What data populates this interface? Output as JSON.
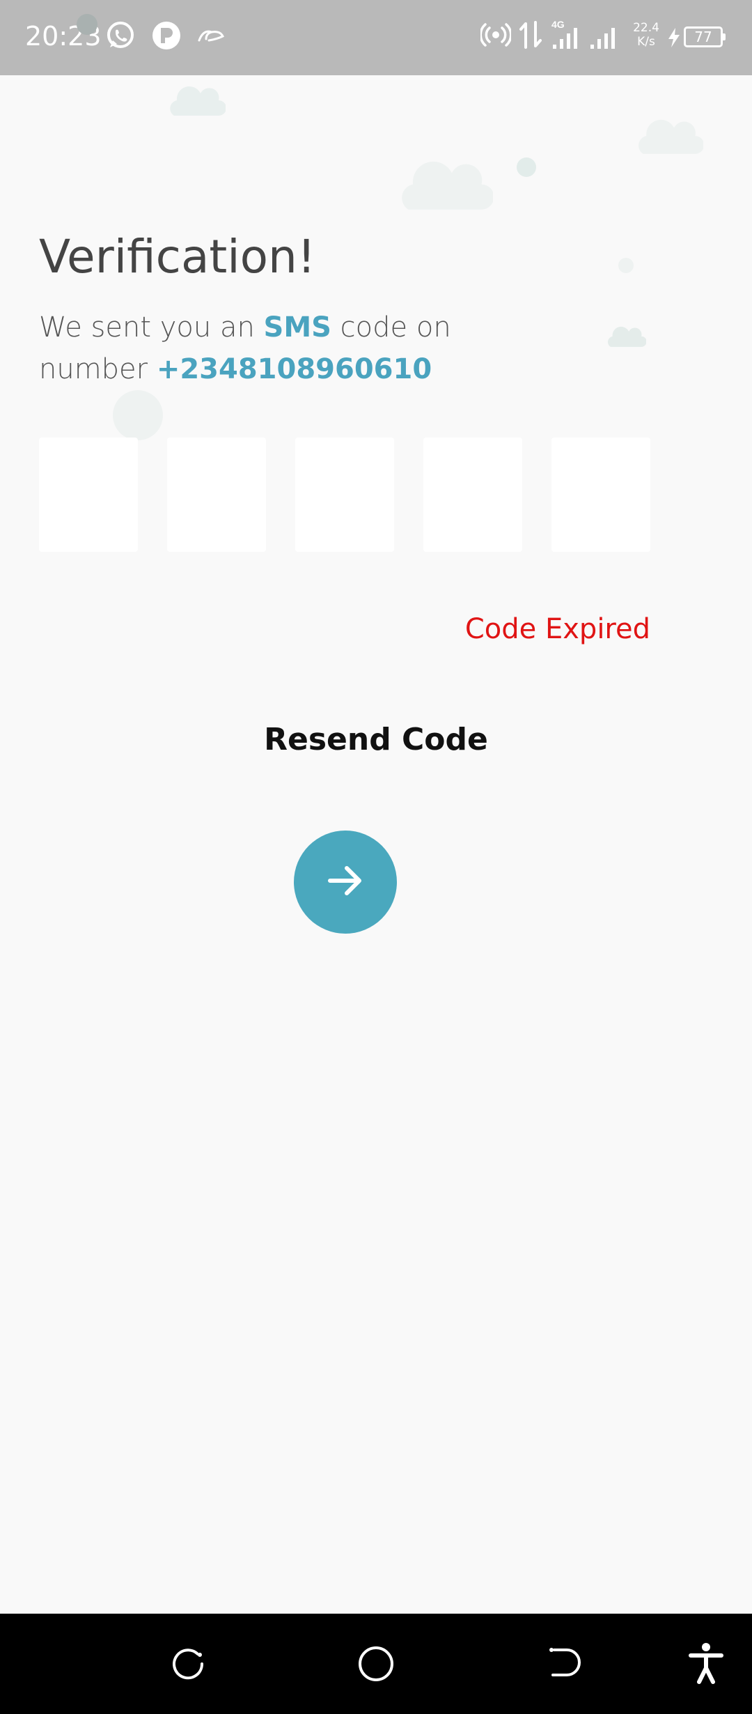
{
  "status_bar": {
    "time": "20:23",
    "network_type": "4G",
    "speed_value": "22.4",
    "speed_unit": "K/s",
    "battery_level": "77"
  },
  "verification": {
    "title": "Verification!",
    "subtitle_prefix": "We sent you an ",
    "subtitle_highlight": "SMS",
    "subtitle_middle": " code on number ",
    "phone_number": "+2348108960610",
    "code_digits": [
      "",
      "",
      "",
      "",
      ""
    ],
    "status_message": "Code Expired",
    "resend_label": "Resend Code"
  },
  "colors": {
    "accent": "#4aa3bf",
    "error": "#e01414",
    "status_bar": "#b9b9b9",
    "background": "#f9f9f9"
  }
}
